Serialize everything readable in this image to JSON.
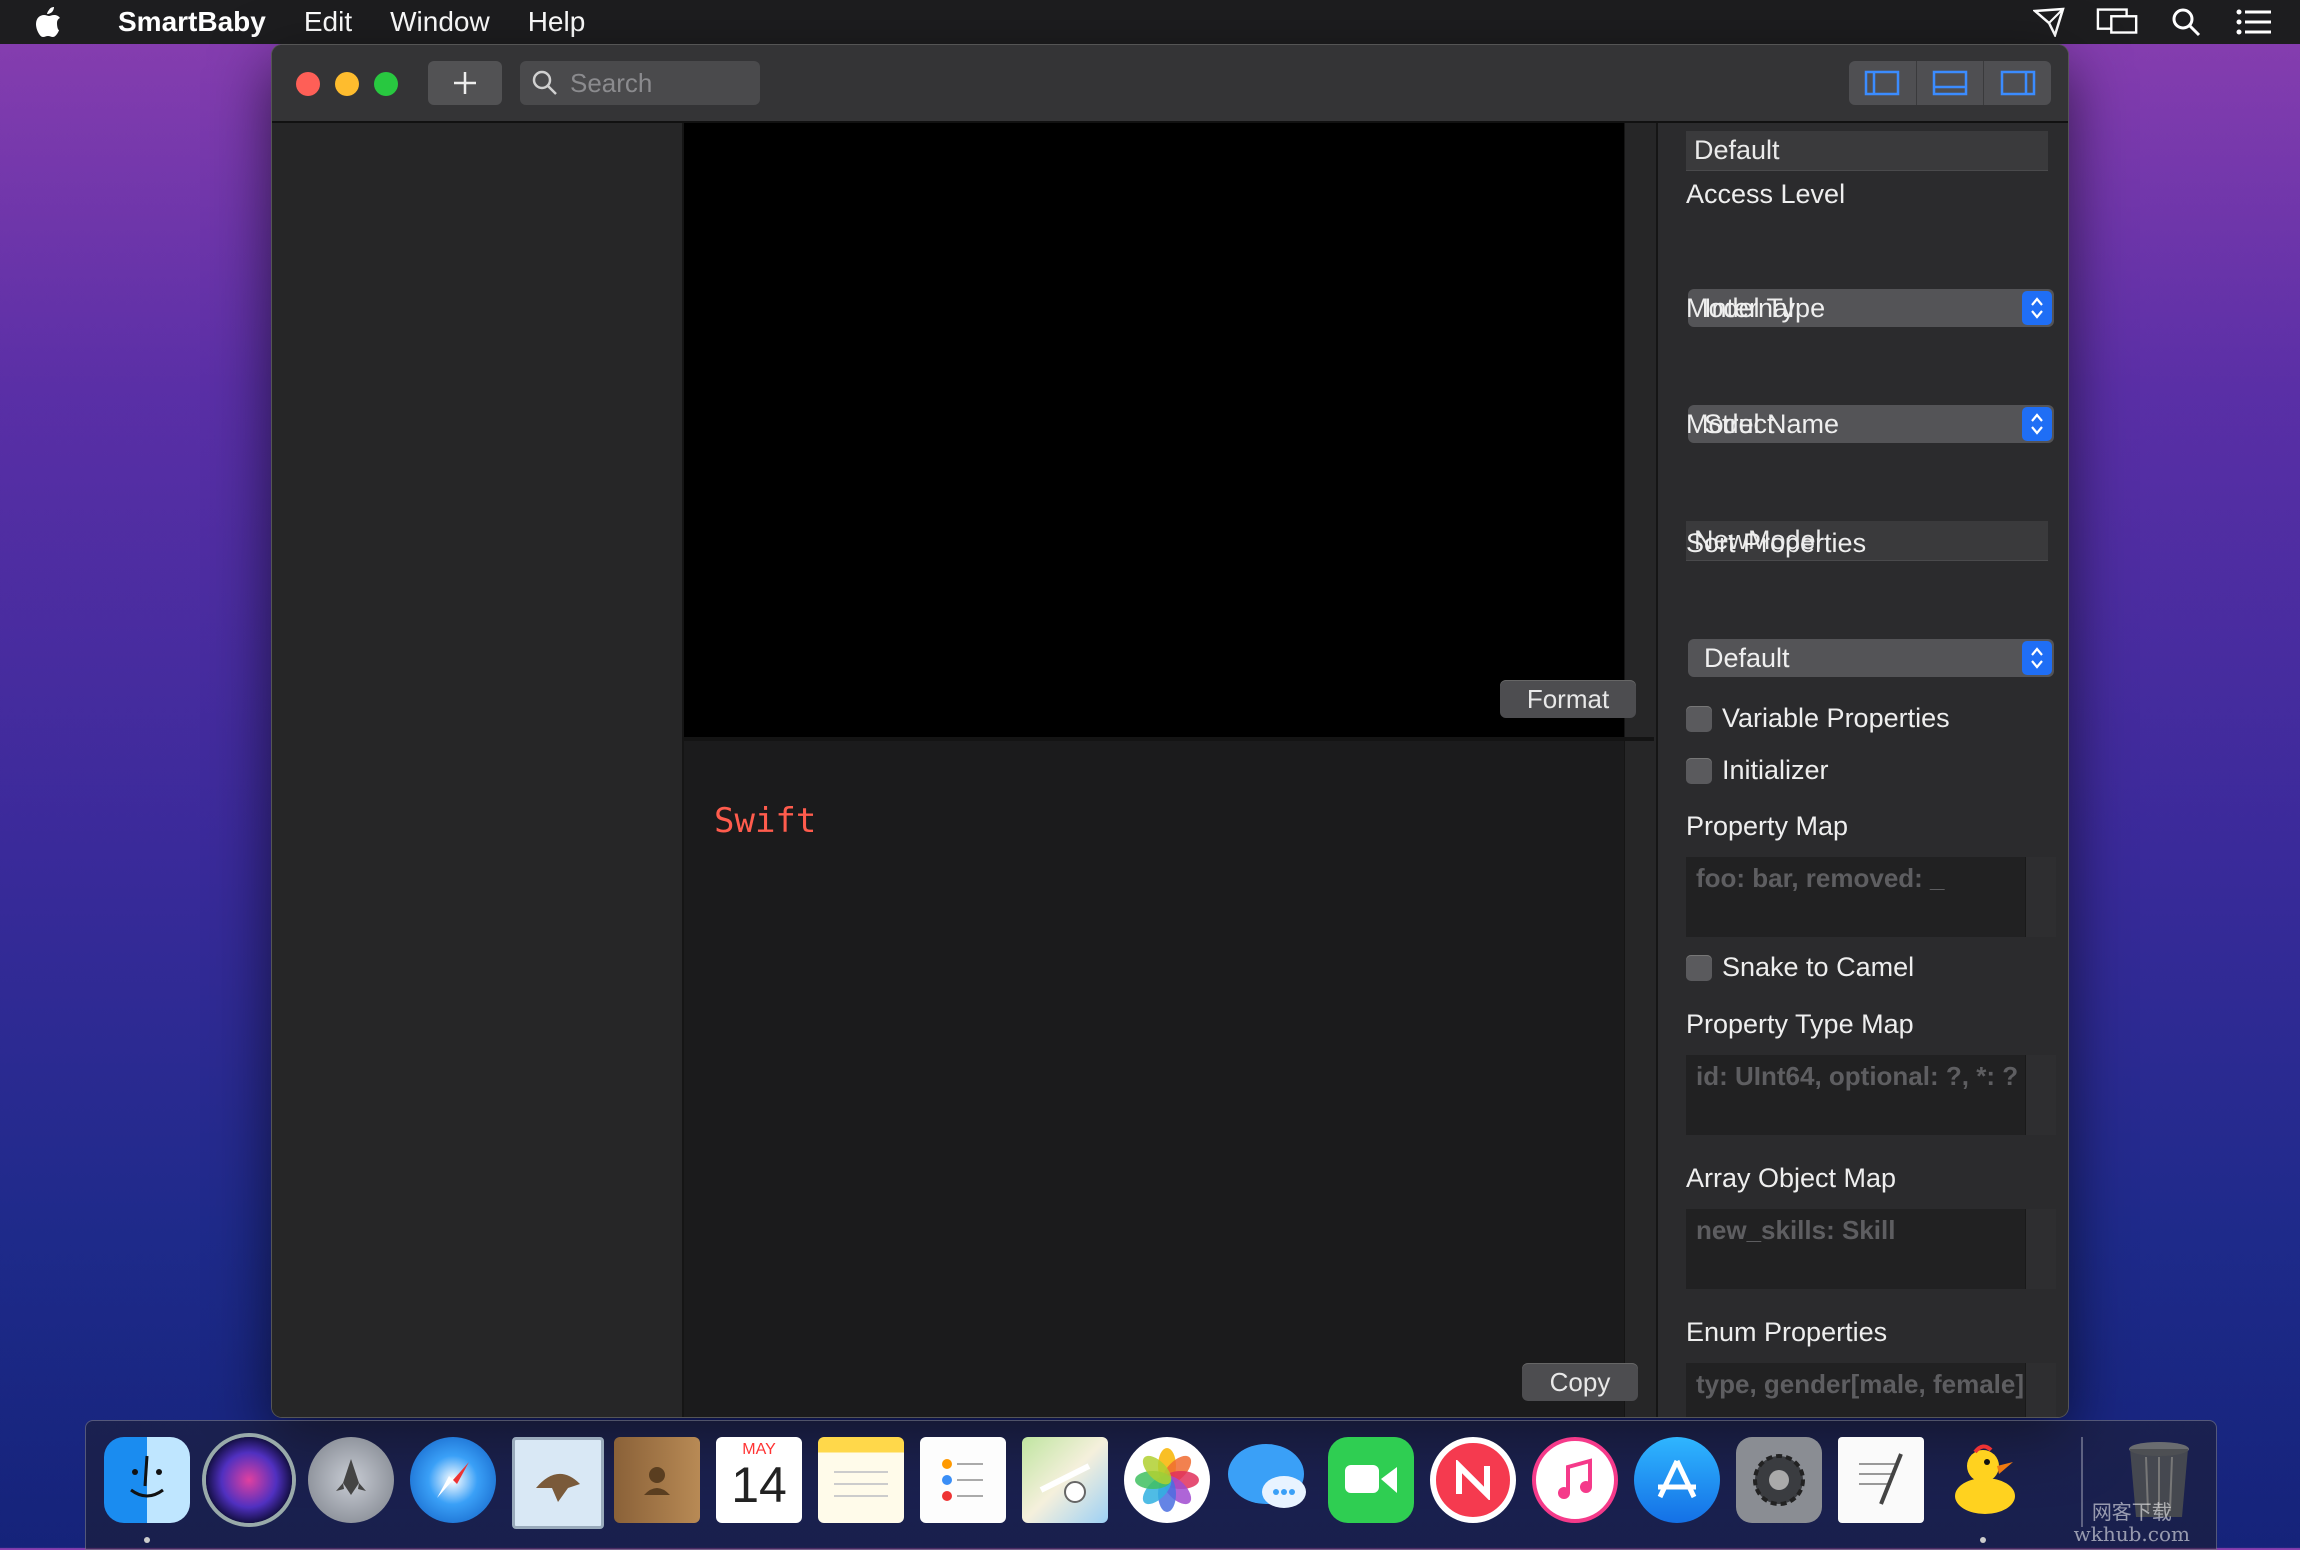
{
  "menubar": {
    "app_name": "SmartBaby",
    "items": [
      "Edit",
      "Window",
      "Help"
    ]
  },
  "toolbar": {
    "add_label": "+",
    "search_placeholder": "Search"
  },
  "editor": {
    "language_label": "Swift",
    "format_button": "Format",
    "copy_button": "Copy"
  },
  "inspector": {
    "top_field_value": "Default",
    "access_level_label": "Access Level",
    "access_level_value": "Internal",
    "model_type_label": "Model Type",
    "model_type_value": "Struct",
    "model_name_label": "Model Name",
    "model_name_value": "NewModel",
    "sort_properties_label": "Sort Properties",
    "sort_properties_value": "Default",
    "variable_properties_label": "Variable Properties",
    "initializer_label": "Initializer",
    "property_map_label": "Property Map",
    "property_map_placeholder": "foo: bar, removed: _",
    "snake_to_camel_label": "Snake to Camel",
    "property_type_map_label": "Property Type Map",
    "property_type_map_placeholder": "id: UInt64, optional: ?, *: ?",
    "array_object_map_label": "Array Object Map",
    "array_object_map_placeholder": "new_skills: Skill",
    "enum_properties_label": "Enum Properties",
    "enum_properties_placeholder": "type, gender[male, female]"
  },
  "dock": {
    "calendar_month": "MAY",
    "calendar_day": "14",
    "apps": [
      "Finder",
      "Siri",
      "Launchpad",
      "Safari",
      "Mail",
      "Contacts",
      "Calendar",
      "Notes",
      "Reminders",
      "Maps",
      "Photos",
      "Messages",
      "FaceTime",
      "News",
      "iTunes",
      "App Store",
      "System Preferences",
      "TextEdit",
      "Cyberduck",
      "Trash"
    ]
  },
  "watermark": {
    "line1": "网客下载",
    "line2": "wkhub.com"
  },
  "colors": {
    "accent": "#1f6ef5",
    "swift_label": "#ff5c4d",
    "close": "#fe5f57",
    "minimize": "#febc2e",
    "maximize": "#28c840"
  }
}
